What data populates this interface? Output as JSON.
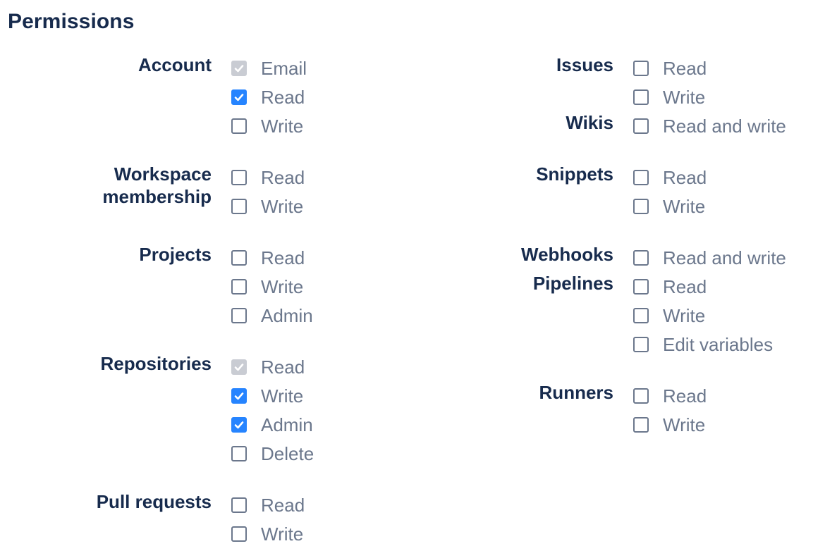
{
  "title": "Permissions",
  "left": [
    {
      "label": "Account",
      "options": [
        {
          "label": "Email",
          "state": "disabled"
        },
        {
          "label": "Read",
          "state": "checked"
        },
        {
          "label": "Write",
          "state": "unchecked"
        }
      ]
    },
    {
      "label": "Workspace membership",
      "options": [
        {
          "label": "Read",
          "state": "unchecked"
        },
        {
          "label": "Write",
          "state": "unchecked"
        }
      ]
    },
    {
      "label": "Projects",
      "options": [
        {
          "label": "Read",
          "state": "unchecked"
        },
        {
          "label": "Write",
          "state": "unchecked"
        },
        {
          "label": "Admin",
          "state": "unchecked"
        }
      ]
    },
    {
      "label": "Repositories",
      "options": [
        {
          "label": "Read",
          "state": "disabled"
        },
        {
          "label": "Write",
          "state": "checked"
        },
        {
          "label": "Admin",
          "state": "checked"
        },
        {
          "label": "Delete",
          "state": "unchecked"
        }
      ]
    },
    {
      "label": "Pull requests",
      "options": [
        {
          "label": "Read",
          "state": "unchecked"
        },
        {
          "label": "Write",
          "state": "unchecked"
        }
      ]
    }
  ],
  "right": [
    {
      "label": "Issues",
      "options": [
        {
          "label": "Read",
          "state": "unchecked"
        },
        {
          "label": "Write",
          "state": "unchecked"
        }
      ]
    },
    {
      "label": "Wikis",
      "options": [
        {
          "label": "Read and write",
          "state": "unchecked"
        }
      ]
    },
    {
      "label": "Snippets",
      "options": [
        {
          "label": "Read",
          "state": "unchecked"
        },
        {
          "label": "Write",
          "state": "unchecked"
        }
      ]
    },
    {
      "label": "Webhooks",
      "options": [
        {
          "label": "Read and write",
          "state": "unchecked"
        }
      ]
    },
    {
      "label": "Pipelines",
      "options": [
        {
          "label": "Read",
          "state": "unchecked"
        },
        {
          "label": "Write",
          "state": "unchecked"
        },
        {
          "label": "Edit variables",
          "state": "unchecked"
        }
      ]
    },
    {
      "label": "Runners",
      "options": [
        {
          "label": "Read",
          "state": "unchecked"
        },
        {
          "label": "Write",
          "state": "unchecked"
        }
      ]
    }
  ],
  "colors": {
    "heading": "#172b4d",
    "option_text": "#6b778c",
    "checked": "#2684ff",
    "disabled": "#c9ccd3"
  }
}
